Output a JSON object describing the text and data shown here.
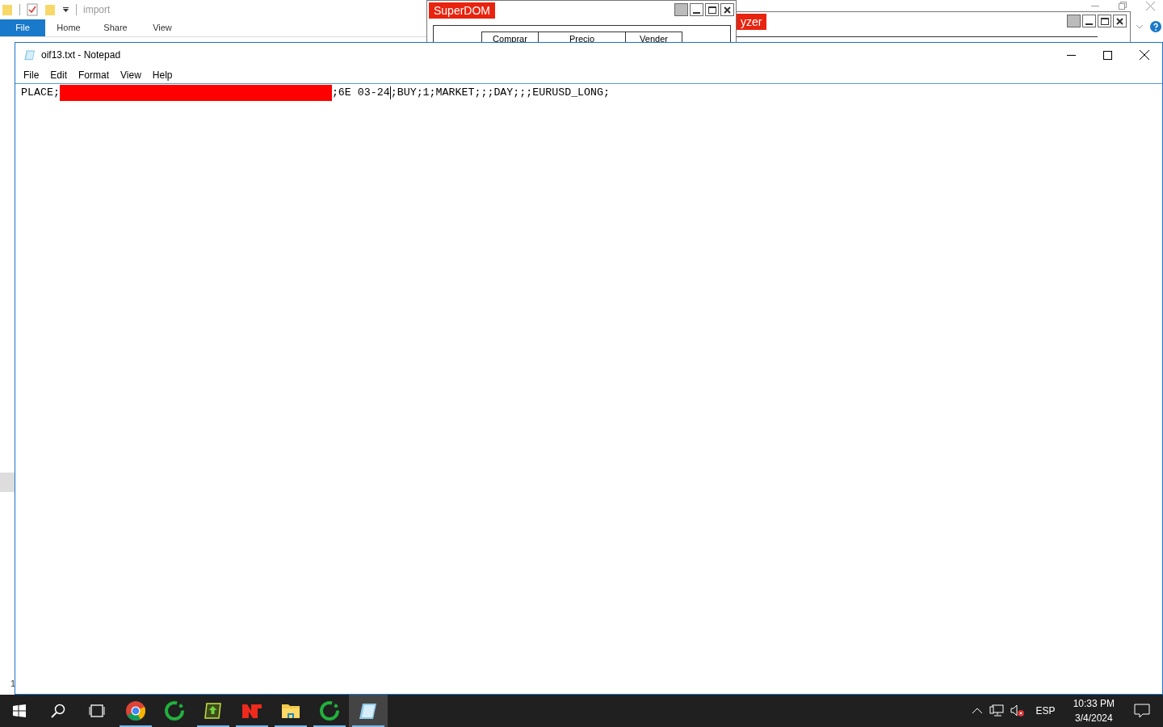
{
  "explorer": {
    "title": "import",
    "ribbon_tabs": [
      {
        "label": "File",
        "selected": true
      },
      {
        "label": "Home",
        "selected": false
      },
      {
        "label": "Share",
        "selected": false
      },
      {
        "label": "View",
        "selected": false
      }
    ]
  },
  "superdom": {
    "title": "SuperDOM",
    "columns": [
      "Comprar",
      "Precio",
      "Vender"
    ]
  },
  "analyzer": {
    "title": "yzer"
  },
  "notepad": {
    "title": "oif13.txt - Notepad",
    "menu": [
      "File",
      "Edit",
      "Format",
      "View",
      "Help"
    ],
    "editor": {
      "prefix": "PLACE;",
      "redacted": true,
      "before_caret": ";6E 03-24",
      "after_caret": ";BUY;1;MARKET;;;DAY;;;EURUSD_LONG;"
    }
  },
  "edge_text": "1",
  "taskbar": {
    "apps": [
      {
        "kind": "chrome",
        "running": true,
        "selected": false
      },
      {
        "kind": "ring",
        "running": false,
        "selected": false
      },
      {
        "kind": "arrow",
        "running": true,
        "selected": false
      },
      {
        "kind": "nt",
        "running": true,
        "selected": false
      },
      {
        "kind": "folder",
        "running": true,
        "selected": false
      },
      {
        "kind": "ring",
        "running": true,
        "selected": false
      },
      {
        "kind": "notepad",
        "running": true,
        "selected": true
      }
    ],
    "language": "ESP",
    "time": "10:33 PM",
    "date": "3/4/2024"
  }
}
